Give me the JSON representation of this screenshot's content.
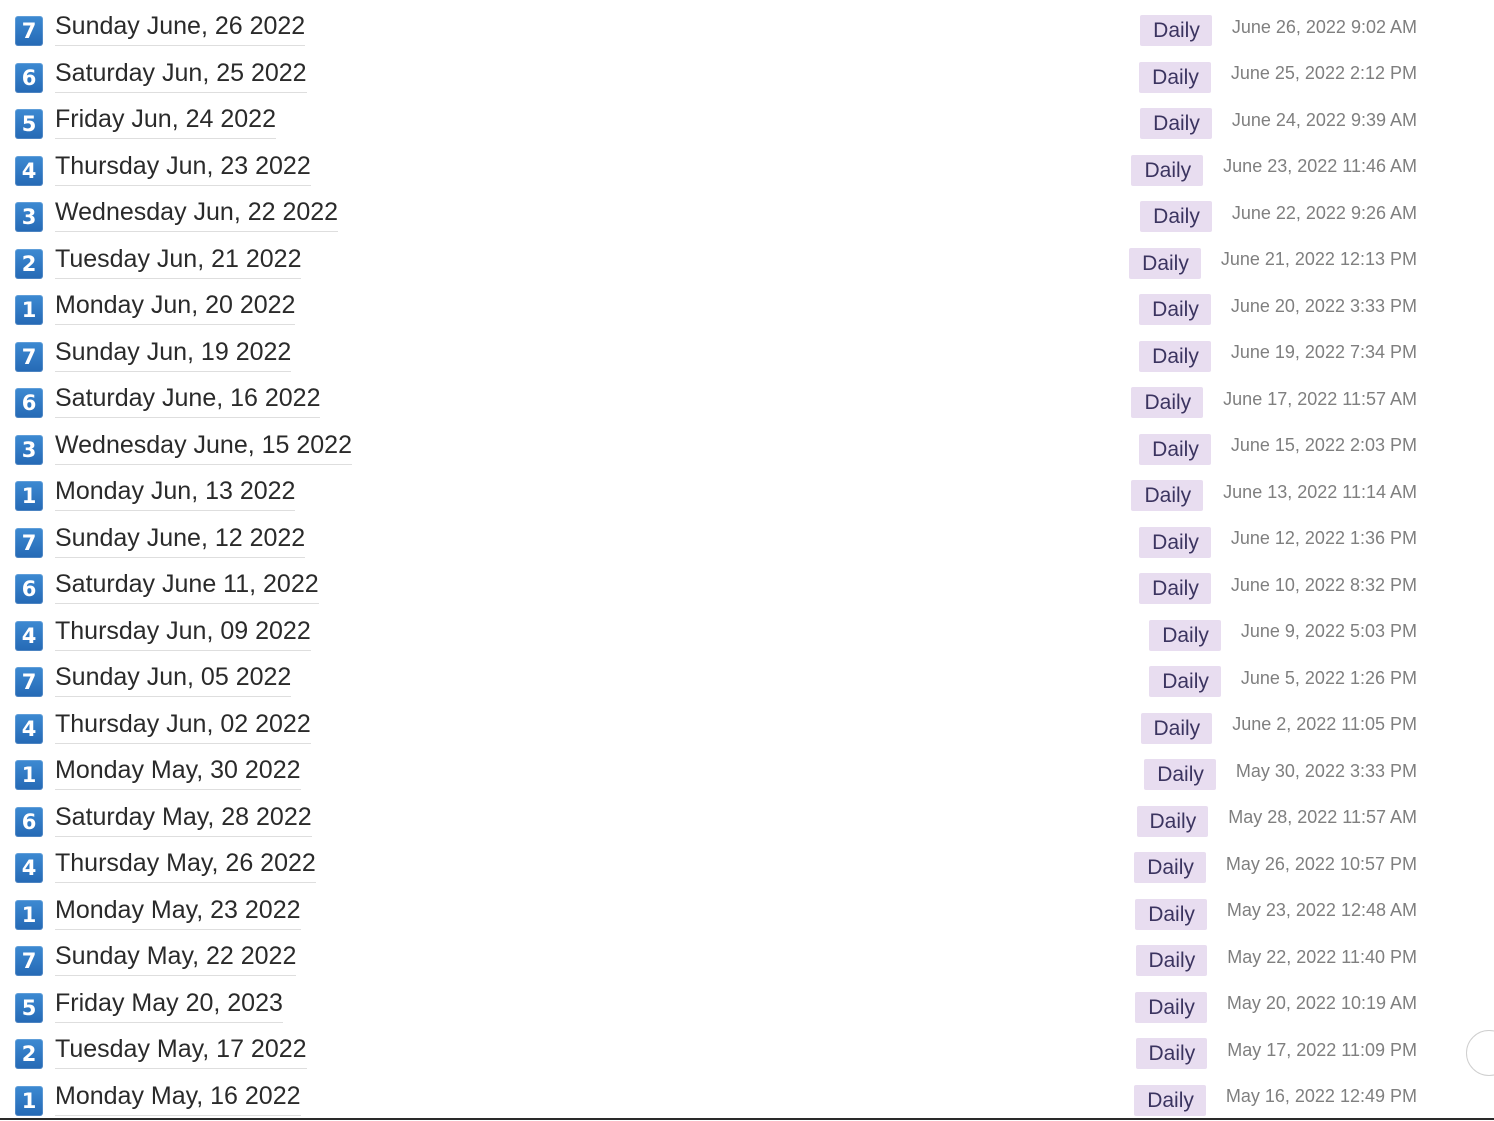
{
  "entries": [
    {
      "day_number": "7",
      "title": "Sunday June, 26 2022",
      "category": "Daily",
      "timestamp": "June 26, 2022 9:02 AM"
    },
    {
      "day_number": "6",
      "title": "Saturday Jun, 25 2022",
      "category": "Daily",
      "timestamp": "June 25, 2022 2:12 PM"
    },
    {
      "day_number": "5",
      "title": "Friday Jun, 24 2022",
      "category": "Daily",
      "timestamp": "June 24, 2022 9:39 AM"
    },
    {
      "day_number": "4",
      "title": "Thursday Jun, 23 2022",
      "category": "Daily",
      "timestamp": "June 23, 2022 11:46 AM"
    },
    {
      "day_number": "3",
      "title": "Wednesday Jun, 22 2022",
      "category": "Daily",
      "timestamp": "June 22, 2022 9:26 AM"
    },
    {
      "day_number": "2",
      "title": "Tuesday Jun, 21 2022",
      "category": "Daily",
      "timestamp": "June 21, 2022 12:13 PM"
    },
    {
      "day_number": "1",
      "title": "Monday Jun, 20 2022",
      "category": "Daily",
      "timestamp": "June 20, 2022 3:33 PM"
    },
    {
      "day_number": "7",
      "title": "Sunday Jun, 19 2022",
      "category": "Daily",
      "timestamp": "June 19, 2022 7:34 PM"
    },
    {
      "day_number": "6",
      "title": "Saturday June, 16 2022",
      "category": "Daily",
      "timestamp": "June 17, 2022 11:57 AM"
    },
    {
      "day_number": "3",
      "title": "Wednesday June, 15 2022",
      "category": "Daily",
      "timestamp": "June 15, 2022 2:03 PM"
    },
    {
      "day_number": "1",
      "title": "Monday Jun, 13 2022",
      "category": "Daily",
      "timestamp": "June 13, 2022 11:14 AM"
    },
    {
      "day_number": "7",
      "title": "Sunday June, 12 2022",
      "category": "Daily",
      "timestamp": "June 12, 2022 1:36 PM"
    },
    {
      "day_number": "6",
      "title": "Saturday June 11, 2022",
      "category": "Daily",
      "timestamp": "June 10, 2022 8:32 PM"
    },
    {
      "day_number": "4",
      "title": "Thursday Jun, 09 2022",
      "category": "Daily",
      "timestamp": "June 9, 2022 5:03 PM"
    },
    {
      "day_number": "7",
      "title": "Sunday Jun, 05 2022",
      "category": "Daily",
      "timestamp": "June 5, 2022 1:26 PM"
    },
    {
      "day_number": "4",
      "title": "Thursday Jun, 02 2022",
      "category": "Daily",
      "timestamp": "June 2, 2022 11:05 PM"
    },
    {
      "day_number": "1",
      "title": "Monday May, 30 2022",
      "category": "Daily",
      "timestamp": "May 30, 2022 3:33 PM"
    },
    {
      "day_number": "6",
      "title": "Saturday May, 28 2022",
      "category": "Daily",
      "timestamp": "May 28, 2022 11:57 AM"
    },
    {
      "day_number": "4",
      "title": "Thursday May, 26 2022",
      "category": "Daily",
      "timestamp": "May 26, 2022 10:57 PM"
    },
    {
      "day_number": "1",
      "title": "Monday May, 23 2022",
      "category": "Daily",
      "timestamp": "May 23, 2022 12:48 AM"
    },
    {
      "day_number": "7",
      "title": "Sunday May, 22 2022",
      "category": "Daily",
      "timestamp": "May 22, 2022 11:40 PM"
    },
    {
      "day_number": "5",
      "title": "Friday May 20, 2023",
      "category": "Daily",
      "timestamp": "May 20, 2022 10:19 AM"
    },
    {
      "day_number": "2",
      "title": "Tuesday May, 17 2022",
      "category": "Daily",
      "timestamp": "May 17, 2022 11:09 PM"
    },
    {
      "day_number": "1",
      "title": "Monday May, 16 2022",
      "category": "Daily",
      "timestamp": "May 16, 2022 12:49 PM"
    }
  ]
}
